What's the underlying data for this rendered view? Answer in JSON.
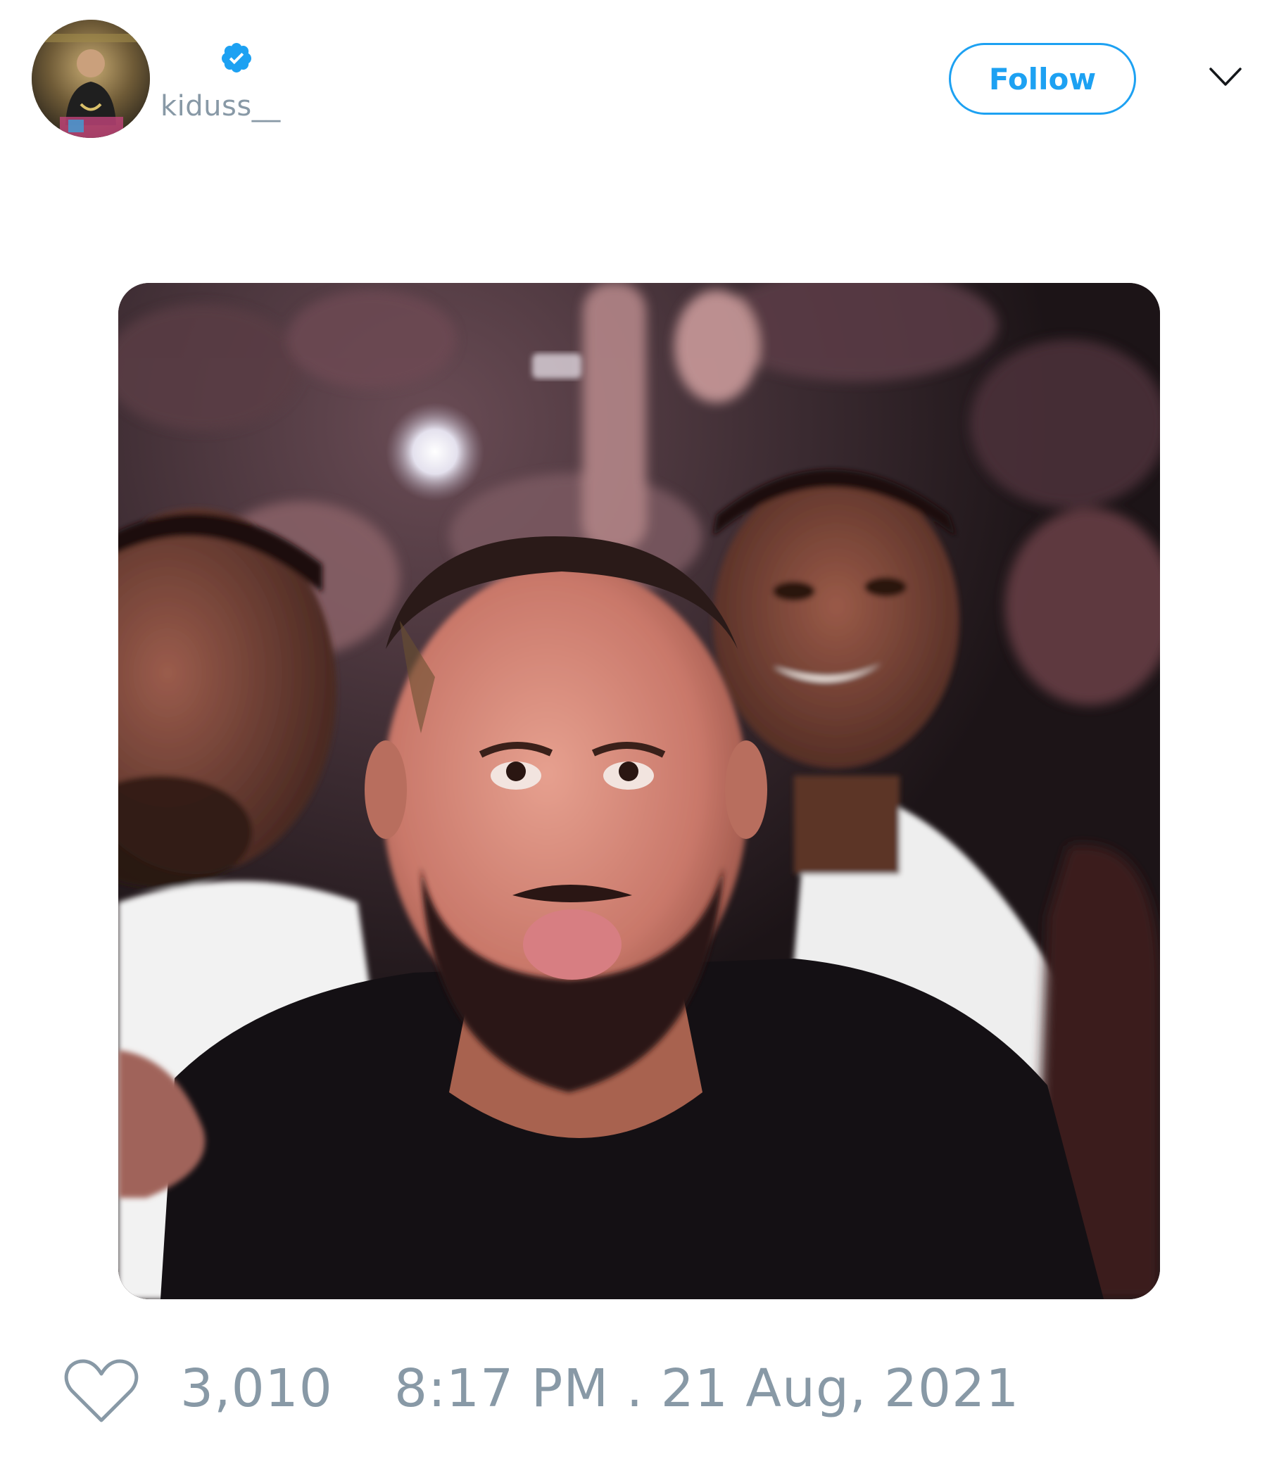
{
  "tweet": {
    "author": {
      "handle": "kiduss__",
      "verified": true,
      "avatar_icon": "avatar-photo"
    },
    "follow_label": "Follow",
    "menu_icon": "chevron-down-icon",
    "media_icon": "photo",
    "like_count": "3,010",
    "timestamp": "8:17 PM . 21 Aug, 2021"
  },
  "colors": {
    "accent": "#1da1f2",
    "muted_text": "#8899a6",
    "background": "#ffffff"
  }
}
